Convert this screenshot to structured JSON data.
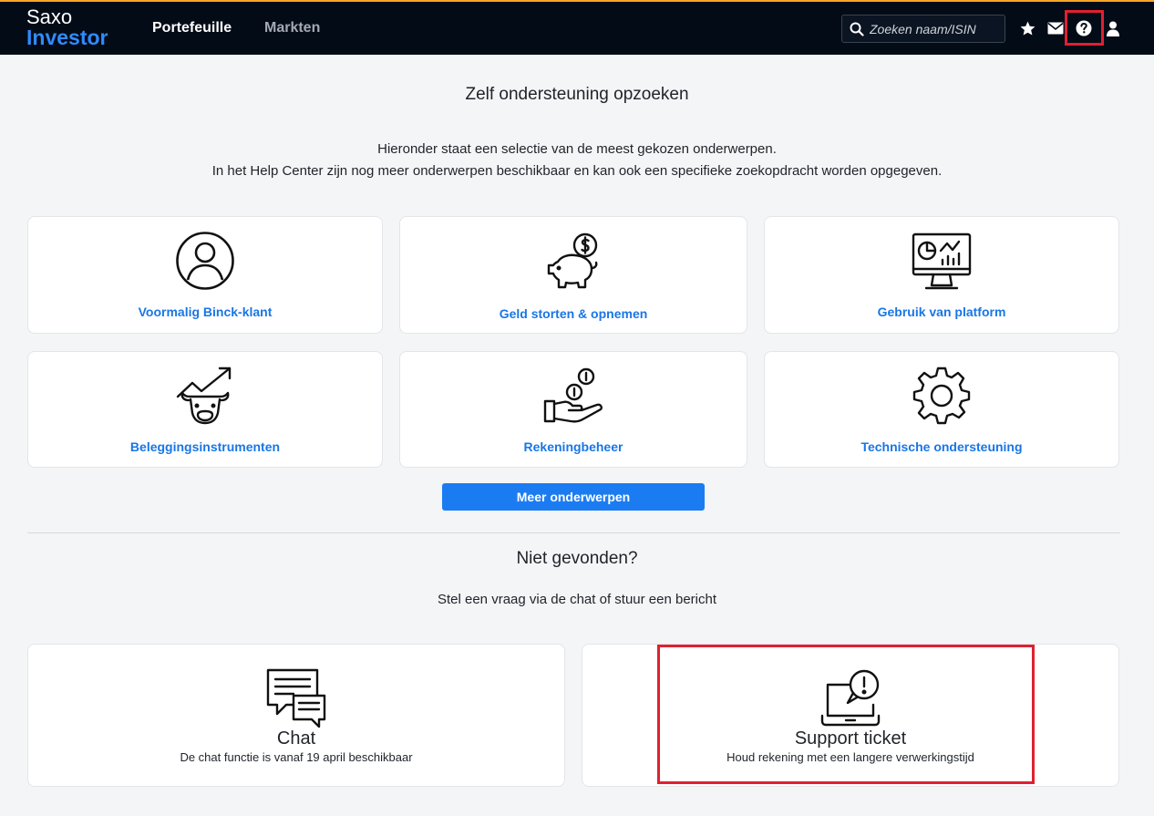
{
  "brand": {
    "line1": "Saxo",
    "line2": "Investor"
  },
  "nav": {
    "portefeuille": "Portefeuille",
    "markten": "Markten"
  },
  "search": {
    "placeholder": "Zoeken naam/ISIN"
  },
  "colors": {
    "accent": "#1b7cf2",
    "link": "#1976e6",
    "topbar": "#030b17",
    "highlight": "#e02030"
  },
  "main": {
    "title": "Zelf ondersteuning opzoeken",
    "intro_line1": "Hieronder staat een selectie van de meest gekozen onderwerpen.",
    "intro_line2": "In het Help Center zijn nog meer onderwerpen beschikbaar en kan ook een specifieke zoekopdracht worden opgegeven.",
    "topics": [
      {
        "label": "Voormalig Binck-klant",
        "icon": "user-circle-icon"
      },
      {
        "label": "Geld storten & opnemen",
        "icon": "piggy-bank-icon"
      },
      {
        "label": "Gebruik van platform",
        "icon": "monitor-chart-icon"
      },
      {
        "label": "Beleggingsinstrumenten",
        "icon": "bull-chart-icon"
      },
      {
        "label": "Rekeningbeheer",
        "icon": "hand-coins-icon"
      },
      {
        "label": "Technische ondersteuning",
        "icon": "gear-icon"
      }
    ],
    "more_button": "Meer onderwerpen"
  },
  "not_found": {
    "title": "Niet gevonden?",
    "subtitle": "Stel een vraag via de chat of stuur een bericht",
    "chat": {
      "title": "Chat",
      "sub": "De chat functie is vanaf 19 april beschikbaar",
      "icon": "chat-bubbles-icon"
    },
    "ticket": {
      "title": "Support ticket",
      "sub": "Houd rekening met een langere verwerkingstijd",
      "icon": "laptop-alert-icon"
    }
  }
}
